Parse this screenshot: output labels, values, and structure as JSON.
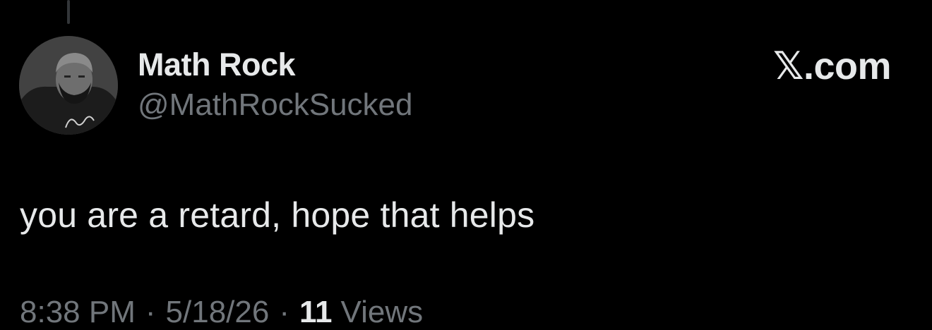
{
  "tweet": {
    "author": {
      "display_name": "Math Rock",
      "handle": "@MathRockSucked"
    },
    "brand": "𝕏.com",
    "text": "you are a retard, hope that helps",
    "meta": {
      "time": "8:38 PM",
      "separator": "·",
      "date": "5/18/26",
      "views_count": "11",
      "views_label": "Views"
    }
  },
  "colors": {
    "background": "#000000",
    "primary_text": "#e7e9ea",
    "secondary_text": "#71767b",
    "thread_line": "#333639"
  },
  "icons": {
    "avatar": "avatar-photo"
  }
}
